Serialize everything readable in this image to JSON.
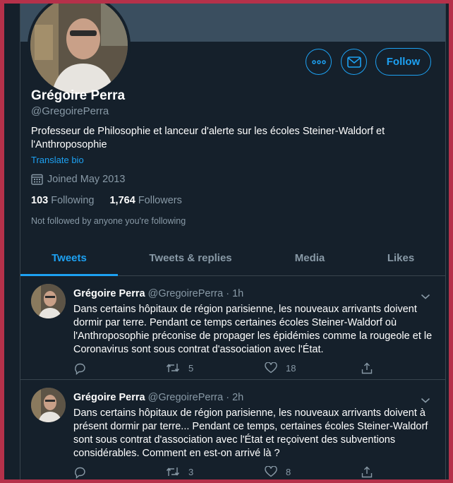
{
  "profile": {
    "name": "Grégoire Perra",
    "handle": "@GregoirePerra",
    "bio": "Professeur de Philosophie et lanceur d'alerte sur les écoles Steiner-Waldorf et l'Anthroposophie",
    "translate_label": "Translate bio",
    "joined": "Joined May 2013",
    "following_count": "103",
    "following_label": "Following",
    "followers_count": "1,764",
    "followers_label": "Followers",
    "not_followed": "Not followed by anyone you're following",
    "follow_label": "Follow"
  },
  "tabs": [
    "Tweets",
    "Tweets & replies",
    "Media",
    "Likes"
  ],
  "tweets": [
    {
      "name": "Grégoire Perra",
      "handle": "@GregoirePerra",
      "sep": "·",
      "time": "1h",
      "text": "Dans certains hôpitaux de région parisienne, les nouveaux arrivants doivent dormir par terre. Pendant ce temps certaines écoles Steiner-Waldorf où l'Anthroposophie préconise de propager les épidémies comme la rougeole et le Coronavirus sont sous contrat d'association avec l'État.",
      "retweets": "5",
      "likes": "18"
    },
    {
      "name": "Grégoire Perra",
      "handle": "@GregoirePerra",
      "sep": "·",
      "time": "2h",
      "text": "Dans certains hôpitaux de région parisienne, les nouveaux arrivants doivent à présent dormir par terre... Pendant ce temps, certaines écoles Steiner-Waldorf sont sous contrat d'association avec l'État et reçoivent des subventions considérables. Comment en est-on arrivé là ?",
      "retweets": "3",
      "likes": "8"
    }
  ],
  "colors": {
    "accent": "#1da1f2",
    "background": "#15202b",
    "frame": "#b5314a"
  }
}
